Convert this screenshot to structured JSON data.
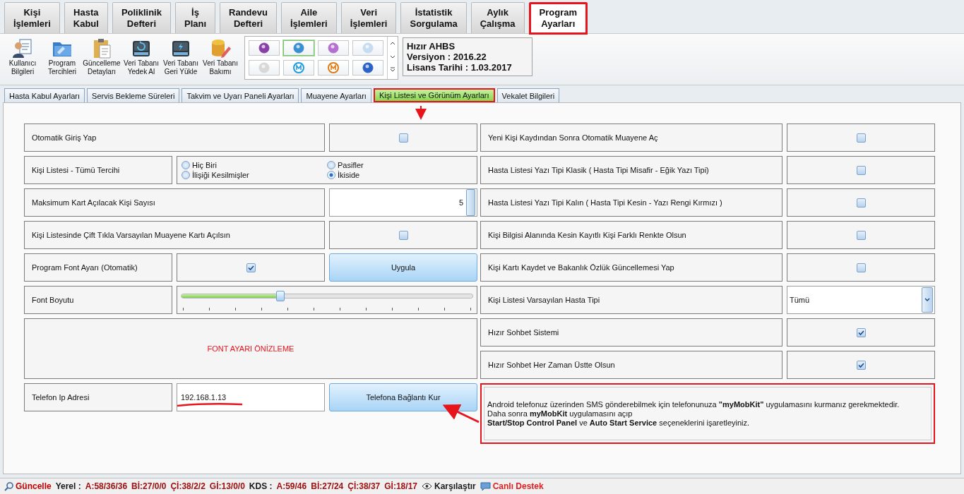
{
  "menu_tabs": [
    {
      "label": "Kişi\nİşlemleri",
      "selected": false,
      "highlighted": false
    },
    {
      "label": "Hasta\nKabul",
      "selected": false,
      "highlighted": false
    },
    {
      "label": "Poliklinik\nDefteri",
      "selected": false,
      "highlighted": false
    },
    {
      "label": "İş\nPlanı",
      "selected": false,
      "highlighted": false
    },
    {
      "label": "Randevu\nDefteri",
      "selected": false,
      "highlighted": false
    },
    {
      "label": "Aile\nİşlemleri",
      "selected": false,
      "highlighted": false
    },
    {
      "label": "Veri\nİşlemleri",
      "selected": false,
      "highlighted": false
    },
    {
      "label": "İstatistik\nSorgulama",
      "selected": false,
      "highlighted": false
    },
    {
      "label": "Aylık\nÇalışma",
      "selected": false,
      "highlighted": false
    },
    {
      "label": "Program\nAyarları",
      "selected": true,
      "highlighted": true
    }
  ],
  "toolbar": [
    {
      "kind": "user",
      "label": "Kullanıcı\nBilgileri"
    },
    {
      "kind": "folder",
      "label": "Program\nTercihleri"
    },
    {
      "kind": "clipboard",
      "label": "Güncelleme\nDetayları"
    },
    {
      "kind": "backup",
      "label": "Veri Tabanı\nYedek Al"
    },
    {
      "kind": "restore",
      "label": "Veri Tabanı\nGeri Yükle"
    },
    {
      "kind": "maintenance",
      "label": "Veri Tabanı\nBakımı"
    }
  ],
  "themes": [
    {
      "color": "#8a3fa8",
      "selected": false
    },
    {
      "color": "#3a8fd0",
      "selected": true
    },
    {
      "color": "#b56fd0",
      "selected": false
    },
    {
      "color": "#c8dcf0",
      "selected": false
    },
    {
      "color": "#d8d8d8",
      "selected": false
    },
    {
      "color": "#1e9be0",
      "selected": false
    },
    {
      "color": "#e07a10",
      "selected": false
    },
    {
      "color": "#2a62c8",
      "selected": false
    }
  ],
  "about": {
    "lines": [
      "Hızır AHBS",
      "Versiyon : 2016.22",
      "Lisans Tarihi : 1.03.2017"
    ]
  },
  "sub_tabs": [
    {
      "label": "Hasta Kabul Ayarları",
      "selected": false,
      "highlighted": false
    },
    {
      "label": "Servis Bekleme Süreleri",
      "selected": false,
      "highlighted": false
    },
    {
      "label": "Takvim ve Uyarı Paneli Ayarları",
      "selected": false,
      "highlighted": false
    },
    {
      "label": "Muayene Ayarları",
      "selected": false,
      "highlighted": false
    },
    {
      "label": "Kişi Listesi ve Görünüm Ayarları",
      "selected": true,
      "highlighted": true
    },
    {
      "label": "Vekalet Bilgileri",
      "selected": false,
      "highlighted": false
    }
  ],
  "left_settings": [
    {
      "kind": "checkbox",
      "label": "Otomatik Giriş Yap",
      "checked": false
    },
    {
      "kind": "radio",
      "label": "Kişi Listesi - Tümü Tercihi",
      "options": [
        {
          "label": "Hiç Biri",
          "selected": false
        },
        {
          "label": "Pasifler",
          "selected": false
        },
        {
          "label": "İlişiği Kesilmişler",
          "selected": false
        },
        {
          "label": "İkiside",
          "selected": true
        }
      ]
    },
    {
      "kind": "spinner",
      "label": "Maksimum Kart Açılacak Kişi Sayısı",
      "value": "5"
    },
    {
      "kind": "checkbox",
      "label": "Kişi Listesinde Çift Tıkla Varsayılan Muayene Kartı Açılsın",
      "checked": false
    },
    {
      "kind": "check_button",
      "label": "Program Font Ayarı (Otomatik)",
      "checked": true,
      "button": "Uygula"
    },
    {
      "kind": "slider",
      "label": "Font Boyutu",
      "level": 0.34
    },
    {
      "kind": "preview",
      "text": "FONT AYARI ÖNİZLEME"
    },
    {
      "kind": "ip",
      "label": "Telefon Ip Adresi",
      "value": "192.168.1.13",
      "underlined": true,
      "button": "Telefona Bağlantı Kur"
    }
  ],
  "right_settings": [
    {
      "kind": "checkbox",
      "label": "Yeni Kişi Kaydından Sonra Otomatik Muayene Aç",
      "checked": false
    },
    {
      "kind": "checkbox",
      "label": "Hasta Listesi Yazı Tipi Klasik ( Hasta Tipi Misafir  - Eğik Yazı Tipi)",
      "checked": false
    },
    {
      "kind": "checkbox",
      "label": "Hasta Listesi Yazı Tipi Kalın ( Hasta Tipi Kesin - Yazı Rengi Kırmızı )",
      "checked": false
    },
    {
      "kind": "checkbox",
      "label": "Kişi Bilgisi Alanında Kesin Kayıtlı Kişi Farklı Renkte Olsun",
      "checked": false
    },
    {
      "kind": "checkbox",
      "label": "Kişi Kartı Kaydet ve Bakanlık Özlük Güncellemesi Yap",
      "checked": false
    },
    {
      "kind": "select",
      "label": "Kişi Listesi Varsayılan Hasta Tipi",
      "value": "Tümü"
    },
    {
      "kind": "checkbox",
      "label": "Hızır Sohbet Sistemi",
      "checked": true
    },
    {
      "kind": "checkbox",
      "label": "Hızır Sohbet Her Zaman Üstte Olsun",
      "checked": true
    },
    {
      "kind": "info",
      "highlighted": true,
      "lines": [
        "Android telefonuz üzerinden SMS gönderebilmek için telefonunuza **\"myMobKit\"** uygulamasını kurmanız gerekmektedir.",
        "Daha sonra **myMobKit** uygulamasını açıp",
        "**Start/Stop Control Panel**  ve **Auto Start Service** seçeneklerini işaretleyiniz."
      ]
    }
  ],
  "status_bar": [
    {
      "kind": "update",
      "text": "Güncelle"
    },
    {
      "kind": "heading",
      "text": "Yerel :"
    },
    {
      "kind": "value",
      "text": "A:58/36/36"
    },
    {
      "kind": "value",
      "text": "Bİ:27/0/0"
    },
    {
      "kind": "value",
      "text": "Çİ:38/2/2"
    },
    {
      "kind": "value",
      "text": "Gİ:13/0/0"
    },
    {
      "kind": "heading",
      "text": "KDS :"
    },
    {
      "kind": "value",
      "text": "A:59/46"
    },
    {
      "kind": "value",
      "text": "Bİ:27/24"
    },
    {
      "kind": "value",
      "text": "Çİ:38/37"
    },
    {
      "kind": "value",
      "text": "Gİ:18/17"
    },
    {
      "kind": "compare",
      "text": "Karşılaştır"
    },
    {
      "kind": "support",
      "text": "Canlı Destek"
    }
  ]
}
